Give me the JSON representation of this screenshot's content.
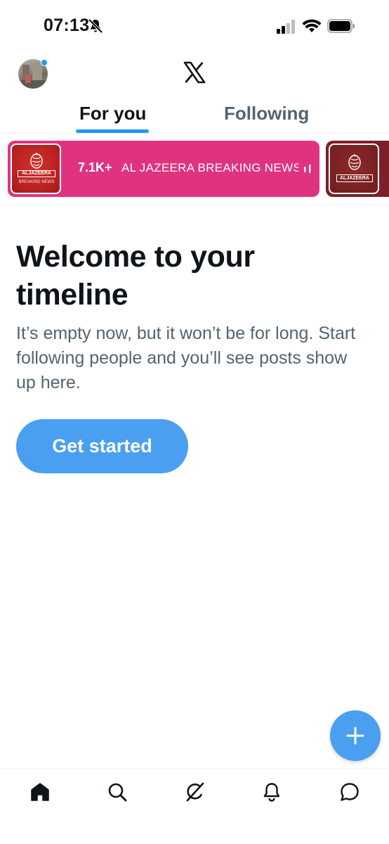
{
  "status_bar": {
    "time": "07:13",
    "icons": [
      "bell-slash-icon",
      "cellular-signal-icon",
      "wifi-icon",
      "battery-icon"
    ]
  },
  "header": {
    "logo": "x-logo-icon",
    "avatar": "profile-avatar"
  },
  "tabs": [
    {
      "label": "For you",
      "selected": true
    },
    {
      "label": "Following",
      "selected": false
    }
  ],
  "live_banner": {
    "count": "7.1K+",
    "title": "AL JAZEERA BREAKING NEWS",
    "thumb_label": "ALJAZEERA",
    "thumb_sub": "BREAKING NEWS",
    "second_thumb_label": "ALJAZEERA",
    "colors": {
      "card": "#e0337f",
      "second_card": "#7c1f26"
    }
  },
  "welcome": {
    "title": "Welcome to your timeline",
    "body": "It’s empty now, but it won’t be for long. Start following people and you’ll see posts show up here.",
    "button_label": "Get started"
  },
  "fab": {
    "icon": "plus-icon"
  },
  "bottom_nav": [
    {
      "name": "home",
      "icon": "home-icon",
      "active": true
    },
    {
      "name": "search",
      "icon": "search-icon",
      "active": false
    },
    {
      "name": "grok",
      "icon": "grok-icon",
      "active": false
    },
    {
      "name": "notifications",
      "icon": "bell-icon",
      "active": false
    },
    {
      "name": "messages",
      "icon": "message-icon",
      "active": false
    }
  ],
  "colors": {
    "accent": "#1d9bf0",
    "button": "#4a9ff0",
    "text_primary": "#0f1419",
    "text_secondary": "#536471"
  }
}
